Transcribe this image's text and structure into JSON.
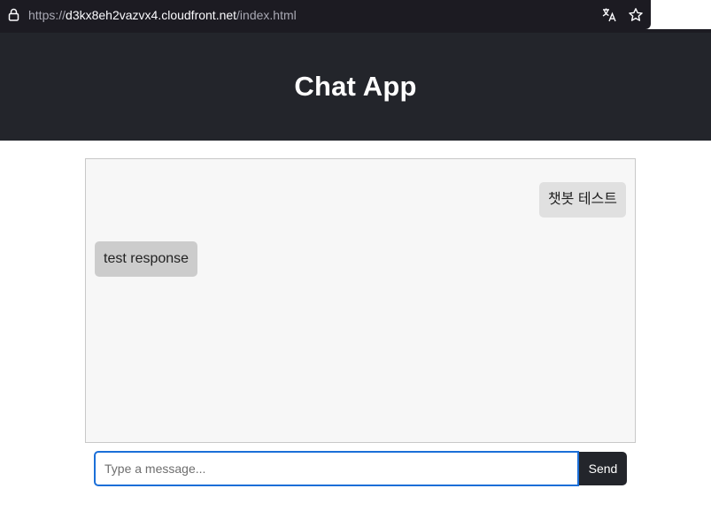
{
  "browser": {
    "url_scheme": "https://",
    "url_host": "d3kx8eh2vazvx4.cloudfront.net",
    "url_path": "/index.html",
    "icons": {
      "lock": "lock-icon",
      "translate": "translate-icon",
      "bookmark": "star-icon"
    }
  },
  "header": {
    "title": "Chat App"
  },
  "chat": {
    "messages": [
      {
        "role": "user",
        "text": "챗봇 테스트"
      },
      {
        "role": "bot",
        "text": "test response"
      }
    ]
  },
  "composer": {
    "placeholder": "Type a message...",
    "value": "",
    "send_label": "Send"
  },
  "colors": {
    "header_bg": "#23252b",
    "chat_bg": "#f7f7f7",
    "user_bubble": "#e0e0e0",
    "bot_bubble": "#cccccc",
    "input_focus_border": "#1b6fd8",
    "send_bg": "#23252b"
  }
}
